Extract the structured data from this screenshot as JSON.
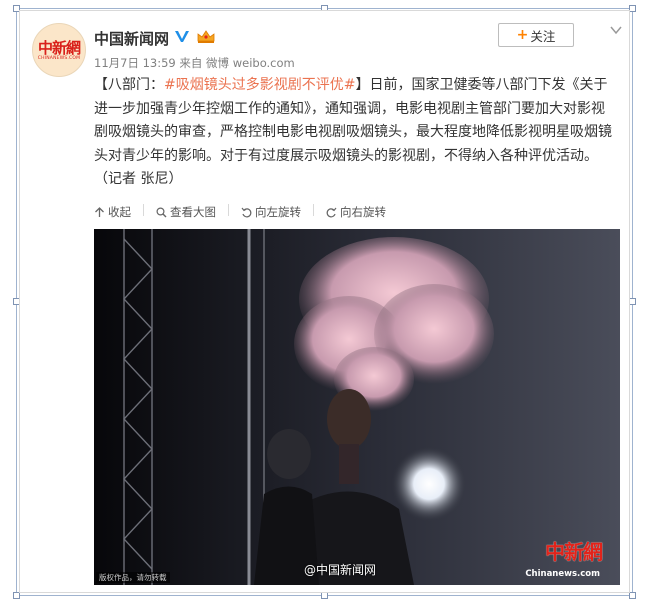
{
  "account": {
    "name": "中国新闻网",
    "avatar_text_cn": "中新網",
    "avatar_text_en": "CHINANEWS.COM",
    "meta_date": "11月7日 13:59",
    "meta_source": "来自 微博 weibo.com",
    "follow_label": "关注"
  },
  "post": {
    "bracket_open": "【",
    "headline": "八部门：",
    "topic": "#吸烟镜头过多影视剧不评优#",
    "bracket_close": "】",
    "body": "日前，国家卫健委等八部门下发《关于进一步加强青少年控烟工作的通知》，通知强调，电影电视剧主管部门要加大对影视剧吸烟镜头的审查，严格控制电影电视剧吸烟镜头，最大程度地降低影视明星吸烟镜头对青少年的影响。对于有过度展示吸烟镜头的影视剧，不得纳入各种评优活动。（记者 张尼）"
  },
  "toolbar": {
    "collapse": "收起",
    "view_large": "查看大图",
    "rotate_left": "向左旋转",
    "rotate_right": "向右旋转"
  },
  "photo": {
    "credit": "版权作品，请勿转载",
    "weibo_watermark": "@中国新闻网",
    "site_watermark_cn": "中新網",
    "site_watermark_en": "Chinanews.com"
  },
  "colors": {
    "topic_link": "#eb7350",
    "follow_plus": "#ff8200",
    "verified_blue": "#1f8fe8",
    "brand_red": "#d9201a"
  },
  "icons": [
    "verified-icon",
    "vip-crown-icon",
    "chevron-down-icon",
    "collapse-icon",
    "zoom-icon",
    "rotate-left-icon",
    "rotate-right-icon"
  ]
}
